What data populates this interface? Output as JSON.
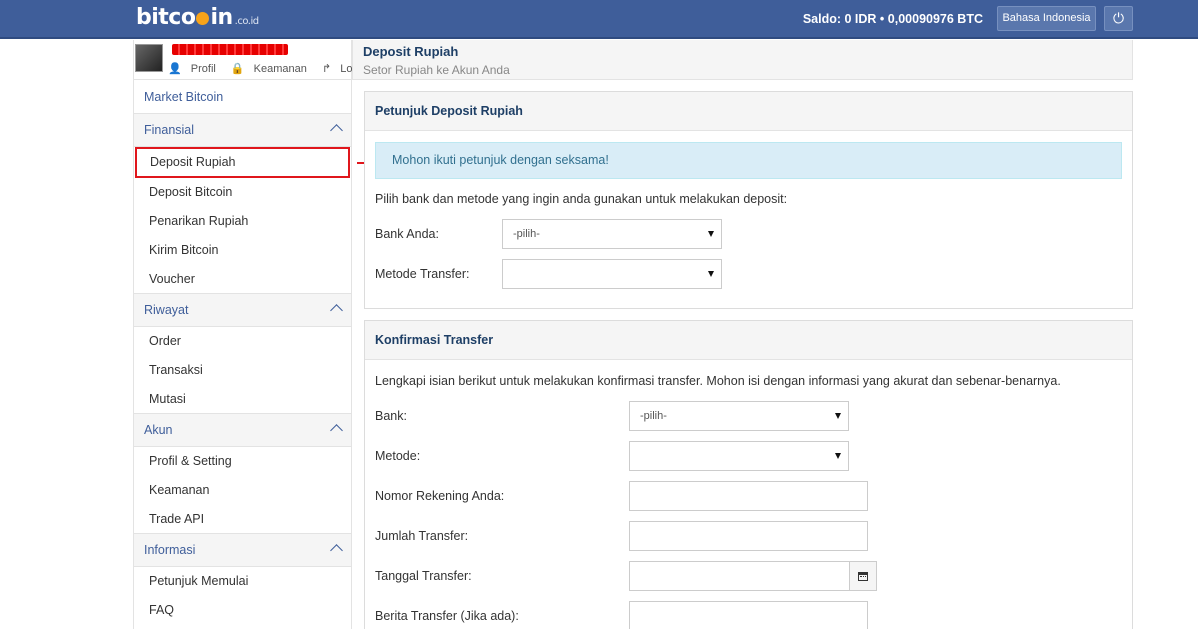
{
  "header": {
    "logo_main": "bitco",
    "logo_end": "in",
    "logo_tld": ".co.id",
    "saldo": "Saldo:  0 IDR  •  0,00090976 BTC",
    "language_button": "Bahasa Indonesia",
    "power_icon": "power-icon"
  },
  "user": {
    "links": [
      "Profil",
      "Keamanan",
      "Logout"
    ]
  },
  "sidebar": {
    "market": "Market Bitcoin",
    "sections": [
      {
        "title": "Finansial",
        "items": [
          "Deposit Rupiah",
          "Deposit Bitcoin",
          "Penarikan Rupiah",
          "Kirim Bitcoin",
          "Voucher"
        ]
      },
      {
        "title": "Riwayat",
        "items": [
          "Order",
          "Transaksi",
          "Mutasi"
        ]
      },
      {
        "title": "Akun",
        "items": [
          "Profil & Setting",
          "Keamanan",
          "Trade API"
        ]
      },
      {
        "title": "Informasi",
        "items": [
          "Petunjuk Memulai",
          "FAQ"
        ]
      }
    ]
  },
  "page": {
    "title": "Deposit Rupiah",
    "subtitle": "Setor Rupiah ke Akun Anda"
  },
  "panel1": {
    "title": "Petunjuk Deposit Rupiah",
    "alert": "Mohon ikuti petunjuk dengan seksama!",
    "instruction": "Pilih bank dan metode yang ingin anda gunakan untuk melakukan deposit:",
    "bank_label": "Bank Anda:",
    "bank_value": "-pilih-",
    "method_label": "Metode Transfer:",
    "method_value": ""
  },
  "panel2": {
    "title": "Konfirmasi Transfer",
    "instruction": "Lengkapi isian berikut untuk melakukan konfirmasi transfer. Mohon isi dengan informasi yang akurat dan sebenar-benarnya.",
    "bank_label": "Bank:",
    "bank_value": "-pilih-",
    "method_label": "Metode:",
    "method_value": "",
    "account_label": "Nomor Rekening Anda:",
    "amount_label": "Jumlah Transfer:",
    "date_label": "Tanggal Transfer:",
    "note_label": "Berita Transfer (Jika ada):"
  }
}
